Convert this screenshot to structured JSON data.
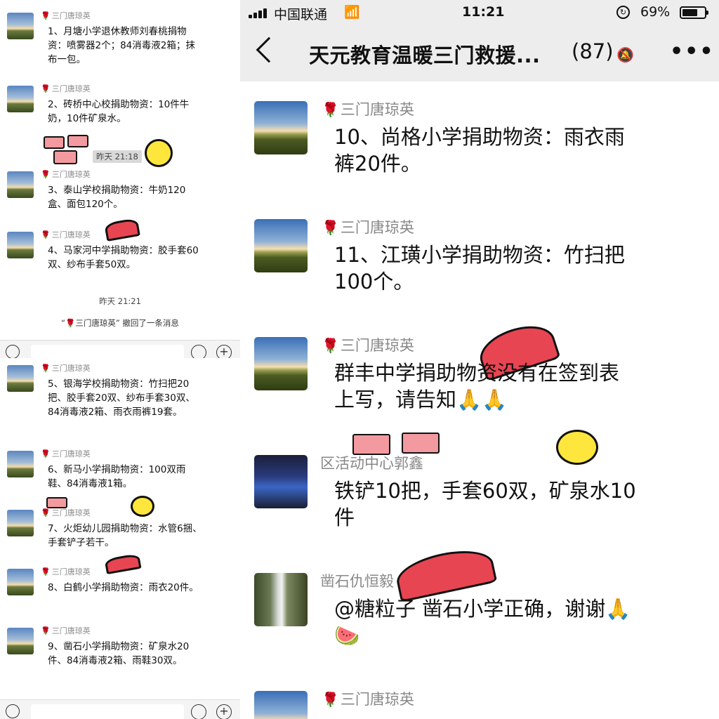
{
  "left_top": {
    "messages": [
      {
        "sender": "三门唐琼英",
        "text": "1、月塘小学退休教师刘春桃捐物资：喷雾器2个；84消毒液2箱；抹布一包。"
      },
      {
        "sender": "三门唐琼英",
        "text": "2、砖桥中心校捐助物资：10件牛奶，10件矿泉水。"
      },
      {
        "sender": "三门唐琼英",
        "text": "3、泰山学校捐助物资：牛奶120盒、面包120个。"
      },
      {
        "sender": "三门唐琼英",
        "text": "4、马家河中学捐助物资：胶手套60双、纱布手套50双。"
      }
    ],
    "sticker_time": "昨天 21:18",
    "time_divider": "昨天 21:21",
    "recall_notice": "“🌹三门唐琼英” 撤回了一条消息"
  },
  "left_bottom": {
    "messages": [
      {
        "sender": "三门唐琼英",
        "text": "5、银海学校捐助物资：竹扫把20把、胶手套20双、纱布手套30双、84消毒液2箱、雨衣雨裤19套。"
      },
      {
        "sender": "三门唐琼英",
        "text": "6、新马小学捐助物资：100双雨鞋、84消毒液1箱。"
      },
      {
        "sender": "三门唐琼英",
        "text": "7、火炬幼儿园捐助物资：水管6捆、手套铲子若干。"
      },
      {
        "sender": "三门唐琼英",
        "text": "8、白鹤小学捐助物资：雨衣20件。"
      },
      {
        "sender": "三门唐琼英",
        "text": "9、凿石小学捐助物资：矿泉水20件、84消毒液2箱、雨鞋30双。"
      }
    ]
  },
  "status_bar": {
    "carrier": "中国联通",
    "time": "11:21",
    "battery": "69%",
    "battery_level": 0.69
  },
  "nav": {
    "title": "天元教育温暖三门救援...",
    "member_count": "(87)"
  },
  "chat": {
    "messages": [
      {
        "sender": "三门唐琼英",
        "text": "10、尚格小学捐助物资：雨衣雨裤20件。"
      },
      {
        "sender": "三门唐琼英",
        "text": "11、江璜小学捐助物资：竹扫把100个。"
      },
      {
        "sender": "三门唐琼英",
        "text": "群丰中学捐助物资没有在签到表上写，请告知🙏🙏"
      },
      {
        "sender": "区活动中心郭鑫",
        "text": "铁铲10把，手套60双，矿泉水10件"
      },
      {
        "sender": "凿石仇恒毅",
        "text": "@糖粒子 凿石小学正确，谢谢🙏🍉"
      },
      {
        "sender": "三门唐琼英",
        "text": ""
      }
    ]
  },
  "colors": {
    "rose": "#c4161c",
    "chat_bg": "#ffffff",
    "header_bg": "#ededed"
  }
}
